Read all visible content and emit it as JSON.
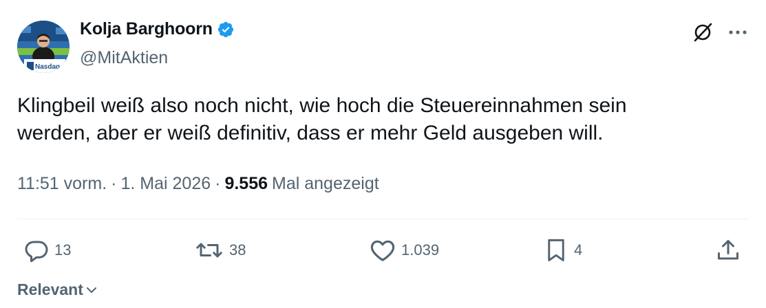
{
  "author": {
    "name": "Kolja Barghoorn",
    "handle": "@MitAktien",
    "verified": true,
    "avatar_badge_text": "Nasdaq"
  },
  "tweet": {
    "text": "Klingbeil weiß also noch nicht, wie hoch die Steuereinnahmen sein\nwerden, aber er weiß definitiv, dass er mehr Geld ausgeben will.",
    "time": "11:51 vorm.",
    "separator": "·",
    "date": "1. Mai 2026",
    "views_count": "9.556",
    "views_label": "Mal angezeigt"
  },
  "actions": {
    "replies": "13",
    "reposts": "38",
    "likes": "1.039",
    "bookmarks": "4"
  },
  "sort": {
    "label": "Relevant"
  },
  "icons": {
    "grok": "grok-icon",
    "more": "more-icon",
    "reply": "reply-icon",
    "repost": "repost-icon",
    "like": "heart-icon",
    "bookmark": "bookmark-icon",
    "share": "share-icon",
    "verified": "verified-badge-icon",
    "chevron": "chevron-down-icon"
  },
  "colors": {
    "text_primary": "#0f1419",
    "text_secondary": "#536471",
    "verified_blue": "#1d9bf0",
    "divider": "#eff3f4"
  }
}
